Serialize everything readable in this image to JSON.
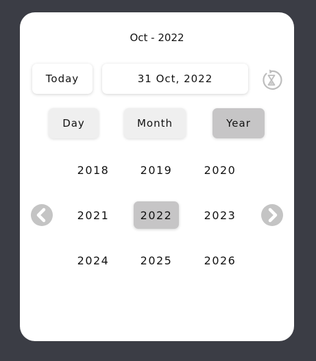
{
  "header": {
    "title": "Oct - 2022"
  },
  "toolbar": {
    "today_label": "Today",
    "selected_date": "31 Oct, 2022",
    "reset_icon": "hourglass-reset-icon"
  },
  "modes": {
    "day": "Day",
    "month": "Month",
    "year": "Year",
    "active": "Year"
  },
  "years": [
    "2018",
    "2019",
    "2020",
    "2021",
    "2022",
    "2023",
    "2024",
    "2025",
    "2026"
  ],
  "selected_year": "2022",
  "nav": {
    "prev_icon": "chevron-left-icon",
    "next_icon": "chevron-right-icon"
  },
  "colors": {
    "background": "#3b3d45",
    "card": "#ffffff",
    "selected": "#c6c5c6",
    "nav": "#c4c4c4"
  }
}
